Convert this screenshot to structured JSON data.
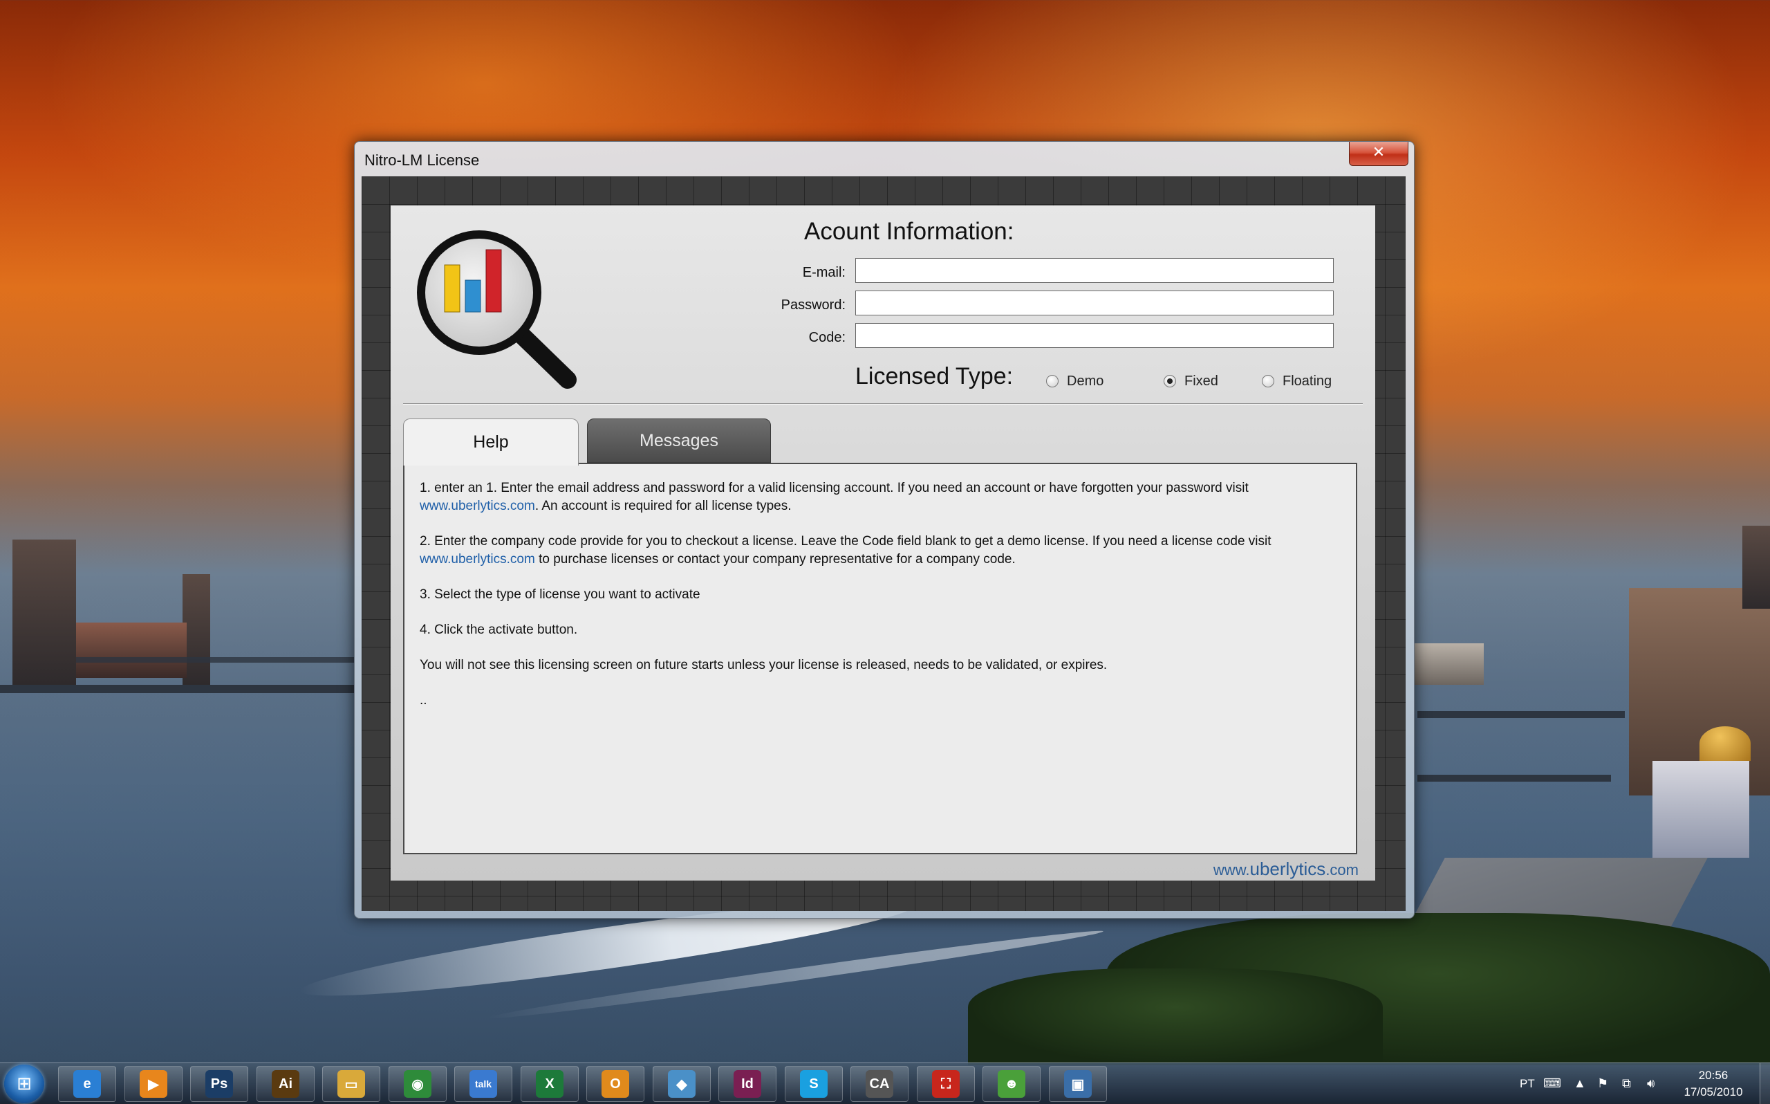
{
  "window": {
    "title": "Nitro-LM License",
    "close_label": "✕"
  },
  "account": {
    "heading": "Acount Information:",
    "email_label": "E-mail:",
    "email_value": "",
    "password_label": "Password:",
    "password_value": "",
    "code_label": "Code:",
    "code_value": ""
  },
  "license_type": {
    "label": "Licensed Type:",
    "options": [
      {
        "label": "Demo",
        "selected": false
      },
      {
        "label": "Fixed",
        "selected": true
      },
      {
        "label": "Floating",
        "selected": false
      }
    ]
  },
  "tabs": [
    {
      "label": "Help",
      "active": true
    },
    {
      "label": "Messages",
      "active": false
    }
  ],
  "help": {
    "p1_a": "1. enter an 1. Enter the email address and password for a valid licensing account. If you need an account or have forgotten your password visit",
    "p1_link": "www.uberlytics.com",
    "p1_b": ". An account is required for all license types.",
    "p2_a": "2. Enter the company code provide for you to checkout a license. Leave the Code field blank to get a demo license. If you need a license code visit",
    "p2_link": "www.uberlytics.com",
    "p2_b": " to purchase licenses or contact your company representative for a company code.",
    "p3": "3. Select the type of license you want to activate",
    "p4": "4. Click the activate button.",
    "p5": "You will not see this licensing screen on future starts unless your license is released, needs to be validated, or expires.",
    "p6": ".."
  },
  "footer": {
    "link_prefix": "www.",
    "link_main": "uberlytics",
    "link_suffix": ".com"
  },
  "taskbar": {
    "items": [
      {
        "name": "internet-explorer-icon",
        "glyph": "e",
        "color": "#2a7fd4"
      },
      {
        "name": "media-player-icon",
        "glyph": "▶",
        "color": "#e8861c"
      },
      {
        "name": "photoshop-icon",
        "glyph": "Ps",
        "color": "#1b3d66"
      },
      {
        "name": "illustrator-icon",
        "glyph": "Ai",
        "color": "#5a3a10"
      },
      {
        "name": "file-explorer-icon",
        "glyph": "▭",
        "color": "#d9a93a"
      },
      {
        "name": "chrome-icon",
        "glyph": "◉",
        "color": "#2e8b3a"
      },
      {
        "name": "google-talk-icon",
        "glyph": "talk",
        "color": "#3a7ad0"
      },
      {
        "name": "excel-icon",
        "glyph": "X",
        "color": "#1d7a3a"
      },
      {
        "name": "outlook-icon",
        "glyph": "O",
        "color": "#e08a1c"
      },
      {
        "name": "notebook-icon",
        "glyph": "◆",
        "color": "#4a90c8"
      },
      {
        "name": "indesign-icon",
        "glyph": "Id",
        "color": "#7a1f52"
      },
      {
        "name": "skype-icon",
        "glyph": "S",
        "color": "#1aa0e0"
      },
      {
        "name": "ca-app-icon",
        "glyph": "CA",
        "color": "#555555"
      },
      {
        "name": "acrobat-icon",
        "glyph": "⛶",
        "color": "#c8261c"
      },
      {
        "name": "messenger-icon",
        "glyph": "☻",
        "color": "#4aa03a"
      },
      {
        "name": "remote-desktop-icon",
        "glyph": "▣",
        "color": "#3a6ea8"
      }
    ],
    "language": "PT",
    "time": "20:56",
    "date": "17/05/2010"
  }
}
